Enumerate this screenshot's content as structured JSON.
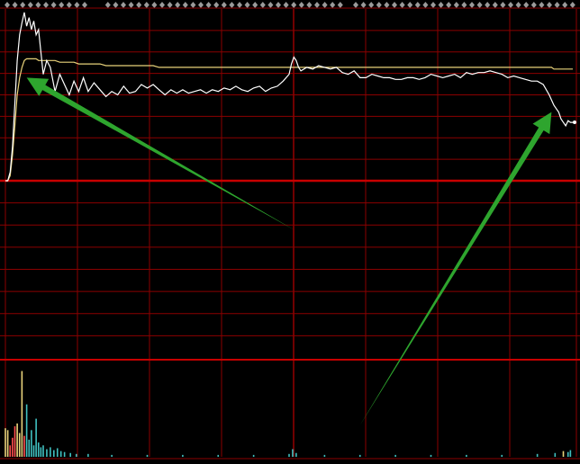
{
  "chart_data": {
    "type": "line",
    "title": "",
    "xlabel": "",
    "ylabel": "",
    "grid": true,
    "colors": {
      "background": "#000000",
      "grid": "#8b0000",
      "baseline": "#c80000",
      "price_line": "#ffffff",
      "avg_line": "#e8d27a",
      "volume_up": "#ff4d4d",
      "volume_down": "#40c0c0",
      "volume_neutral": "#e8d27a",
      "annotation_arrow": "#2ea52e",
      "marker": "#9a9a9a"
    },
    "price_panel": {
      "ylim": [
        -1.0,
        1.0
      ],
      "baseline": 0.0,
      "x": [
        0,
        2,
        4,
        6,
        8,
        10,
        12,
        14,
        16,
        18,
        20,
        22,
        24,
        26,
        28,
        30,
        32,
        35,
        38,
        42,
        46,
        50,
        54,
        58,
        62,
        66,
        70,
        75,
        80,
        85,
        90,
        95,
        100,
        105,
        110,
        115,
        120,
        125,
        130,
        135,
        140,
        145,
        150,
        155,
        160,
        165,
        170,
        175,
        180,
        185,
        190,
        195,
        200,
        205,
        210,
        215,
        220,
        225,
        230,
        235,
        240,
        242,
        244,
        246,
        248,
        250,
        255,
        260,
        265,
        270,
        275,
        280,
        285,
        290,
        295,
        300,
        305,
        310,
        315,
        320,
        325,
        330,
        335,
        340,
        345,
        350,
        355,
        360,
        365,
        370,
        375,
        380,
        385,
        390,
        395,
        400,
        405,
        410,
        415,
        420,
        425,
        430,
        435,
        440,
        445,
        450,
        455,
        460,
        462,
        464,
        466,
        468,
        470,
        472,
        474,
        476,
        478,
        480
      ],
      "series": [
        {
          "values": [
            0.0,
            0.0,
            0.05,
            0.2,
            0.45,
            0.7,
            0.85,
            0.92,
            0.98,
            0.9,
            0.95,
            0.88,
            0.93,
            0.85,
            0.88,
            0.75,
            0.62,
            0.7,
            0.66,
            0.52,
            0.62,
            0.56,
            0.5,
            0.58,
            0.52,
            0.6,
            0.52,
            0.57,
            0.53,
            0.49,
            0.52,
            0.5,
            0.55,
            0.51,
            0.52,
            0.56,
            0.54,
            0.56,
            0.53,
            0.5,
            0.53,
            0.51,
            0.53,
            0.51,
            0.52,
            0.53,
            0.51,
            0.53,
            0.52,
            0.54,
            0.53,
            0.55,
            0.53,
            0.52,
            0.54,
            0.55,
            0.52,
            0.54,
            0.55,
            0.58,
            0.62,
            0.68,
            0.72,
            0.7,
            0.66,
            0.64,
            0.66,
            0.65,
            0.67,
            0.66,
            0.65,
            0.66,
            0.63,
            0.62,
            0.64,
            0.6,
            0.6,
            0.62,
            0.61,
            0.6,
            0.6,
            0.59,
            0.59,
            0.6,
            0.6,
            0.59,
            0.6,
            0.62,
            0.61,
            0.6,
            0.61,
            0.62,
            0.6,
            0.63,
            0.62,
            0.63,
            0.63,
            0.64,
            0.63,
            0.62,
            0.6,
            0.61,
            0.6,
            0.59,
            0.58,
            0.58,
            0.56,
            0.5,
            0.47,
            0.44,
            0.42,
            0.4,
            0.36,
            0.34,
            0.32,
            0.35,
            0.34,
            0.34
          ]
        },
        {
          "values": [
            0.0,
            0.0,
            0.03,
            0.15,
            0.32,
            0.5,
            0.6,
            0.66,
            0.7,
            0.71,
            0.71,
            0.71,
            0.71,
            0.71,
            0.7,
            0.7,
            0.7,
            0.7,
            0.7,
            0.7,
            0.69,
            0.69,
            0.69,
            0.69,
            0.68,
            0.68,
            0.68,
            0.68,
            0.68,
            0.67,
            0.67,
            0.67,
            0.67,
            0.67,
            0.67,
            0.67,
            0.67,
            0.67,
            0.66,
            0.66,
            0.66,
            0.66,
            0.66,
            0.66,
            0.66,
            0.66,
            0.66,
            0.66,
            0.66,
            0.66,
            0.66,
            0.66,
            0.66,
            0.66,
            0.66,
            0.66,
            0.66,
            0.66,
            0.66,
            0.66,
            0.66,
            0.66,
            0.66,
            0.66,
            0.66,
            0.66,
            0.66,
            0.66,
            0.66,
            0.66,
            0.66,
            0.66,
            0.66,
            0.66,
            0.66,
            0.66,
            0.66,
            0.66,
            0.66,
            0.66,
            0.66,
            0.66,
            0.66,
            0.66,
            0.66,
            0.66,
            0.66,
            0.66,
            0.66,
            0.66,
            0.66,
            0.66,
            0.66,
            0.66,
            0.66,
            0.66,
            0.66,
            0.66,
            0.66,
            0.66,
            0.66,
            0.66,
            0.66,
            0.66,
            0.66,
            0.66,
            0.66,
            0.66,
            0.66,
            0.65,
            0.65,
            0.65,
            0.65,
            0.65,
            0.65,
            0.65,
            0.65,
            0.65
          ]
        }
      ]
    },
    "volume_panel": {
      "ylim": [
        0,
        100
      ],
      "bars": [
        {
          "x": 0,
          "value": 30,
          "color": "volume_neutral"
        },
        {
          "x": 2,
          "value": 28,
          "color": "volume_neutral"
        },
        {
          "x": 4,
          "value": 12,
          "color": "volume_up"
        },
        {
          "x": 6,
          "value": 20,
          "color": "volume_up"
        },
        {
          "x": 8,
          "value": 32,
          "color": "volume_up"
        },
        {
          "x": 10,
          "value": 35,
          "color": "volume_neutral"
        },
        {
          "x": 12,
          "value": 25,
          "color": "volume_neutral"
        },
        {
          "x": 14,
          "value": 90,
          "color": "volume_neutral"
        },
        {
          "x": 16,
          "value": 22,
          "color": "volume_up"
        },
        {
          "x": 18,
          "value": 55,
          "color": "volume_down"
        },
        {
          "x": 20,
          "value": 18,
          "color": "volume_down"
        },
        {
          "x": 22,
          "value": 28,
          "color": "volume_down"
        },
        {
          "x": 24,
          "value": 12,
          "color": "volume_down"
        },
        {
          "x": 26,
          "value": 40,
          "color": "volume_down"
        },
        {
          "x": 28,
          "value": 15,
          "color": "volume_down"
        },
        {
          "x": 30,
          "value": 10,
          "color": "volume_down"
        },
        {
          "x": 32,
          "value": 12,
          "color": "volume_down"
        },
        {
          "x": 35,
          "value": 8,
          "color": "volume_down"
        },
        {
          "x": 38,
          "value": 10,
          "color": "volume_down"
        },
        {
          "x": 41,
          "value": 7,
          "color": "volume_down"
        },
        {
          "x": 44,
          "value": 9,
          "color": "volume_down"
        },
        {
          "x": 47,
          "value": 6,
          "color": "volume_down"
        },
        {
          "x": 50,
          "value": 5,
          "color": "volume_down"
        },
        {
          "x": 55,
          "value": 4,
          "color": "volume_down"
        },
        {
          "x": 60,
          "value": 3,
          "color": "volume_down"
        },
        {
          "x": 70,
          "value": 3,
          "color": "volume_down"
        },
        {
          "x": 90,
          "value": 2,
          "color": "volume_down"
        },
        {
          "x": 120,
          "value": 2,
          "color": "volume_down"
        },
        {
          "x": 150,
          "value": 2,
          "color": "volume_down"
        },
        {
          "x": 180,
          "value": 2,
          "color": "volume_down"
        },
        {
          "x": 210,
          "value": 2,
          "color": "volume_down"
        },
        {
          "x": 240,
          "value": 3,
          "color": "volume_down"
        },
        {
          "x": 243,
          "value": 8,
          "color": "volume_down"
        },
        {
          "x": 246,
          "value": 4,
          "color": "volume_down"
        },
        {
          "x": 270,
          "value": 2,
          "color": "volume_down"
        },
        {
          "x": 300,
          "value": 2,
          "color": "volume_down"
        },
        {
          "x": 330,
          "value": 2,
          "color": "volume_down"
        },
        {
          "x": 360,
          "value": 2,
          "color": "volume_down"
        },
        {
          "x": 390,
          "value": 2,
          "color": "volume_down"
        },
        {
          "x": 420,
          "value": 2,
          "color": "volume_down"
        },
        {
          "x": 450,
          "value": 3,
          "color": "volume_down"
        },
        {
          "x": 465,
          "value": 4,
          "color": "volume_down"
        },
        {
          "x": 472,
          "value": 6,
          "color": "volume_neutral"
        },
        {
          "x": 476,
          "value": 5,
          "color": "volume_down"
        },
        {
          "x": 478,
          "value": 7,
          "color": "volume_down"
        }
      ]
    },
    "annotations": [
      {
        "type": "arrow",
        "from": [
          245,
          -0.28
        ],
        "to": [
          18,
          0.6
        ]
      },
      {
        "type": "arrow",
        "from": [
          300,
          -1.38
        ],
        "to": [
          462,
          0.4
        ]
      }
    ]
  }
}
